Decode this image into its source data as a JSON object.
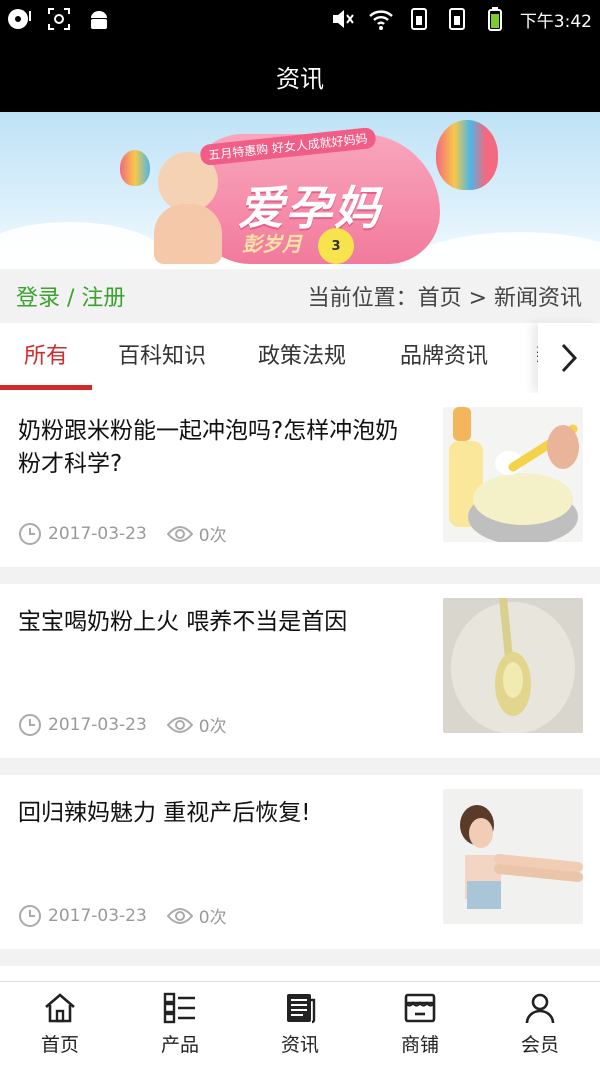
{
  "status_bar": {
    "time": "下午3:42",
    "icons_left": [
      "media-disc-icon",
      "screenshot-icon",
      "android-icon"
    ],
    "icons_right": [
      "mute-icon",
      "wifi-icon",
      "sim1-icon",
      "sim2-icon",
      "battery-icon"
    ]
  },
  "header": {
    "title": "资讯"
  },
  "banner": {
    "tag": "五月特惠购 好女人成就好妈妈",
    "title": "爱孕妈",
    "subtitle": "彭岁月",
    "badge": "3"
  },
  "location_bar": {
    "login_label": "登录 / 注册",
    "breadcrumb": "当前位置：首页 > 新闻资讯"
  },
  "tabs": [
    {
      "label": "所有",
      "active": true
    },
    {
      "label": "百科知识",
      "active": false
    },
    {
      "label": "政策法规",
      "active": false
    },
    {
      "label": "品牌资讯",
      "active": false
    }
  ],
  "articles": [
    {
      "title": "奶粉跟米粉能一起冲泡吗?怎样冲泡奶粉才科学?",
      "date": "2017-03-23",
      "views": "0次",
      "image": "milk-powder-bottle"
    },
    {
      "title": "宝宝喝奶粉上火 喂养不当是首因",
      "date": "2017-03-23",
      "views": "0次",
      "image": "milk-powder-scoop"
    },
    {
      "title": "回归辣妈魅力 重视产后恢复!",
      "date": "2017-03-23",
      "views": "0次",
      "image": "woman-stretching"
    }
  ],
  "bottom_nav": [
    {
      "label": "首页",
      "icon": "home-icon"
    },
    {
      "label": "产品",
      "icon": "product-grid-icon"
    },
    {
      "label": "资讯",
      "icon": "news-icon"
    },
    {
      "label": "商铺",
      "icon": "store-icon"
    },
    {
      "label": "会员",
      "icon": "member-icon"
    }
  ],
  "colors": {
    "accent_red": "#d12a2a",
    "login_green": "#3aa22e",
    "header_bg": "#000000"
  }
}
